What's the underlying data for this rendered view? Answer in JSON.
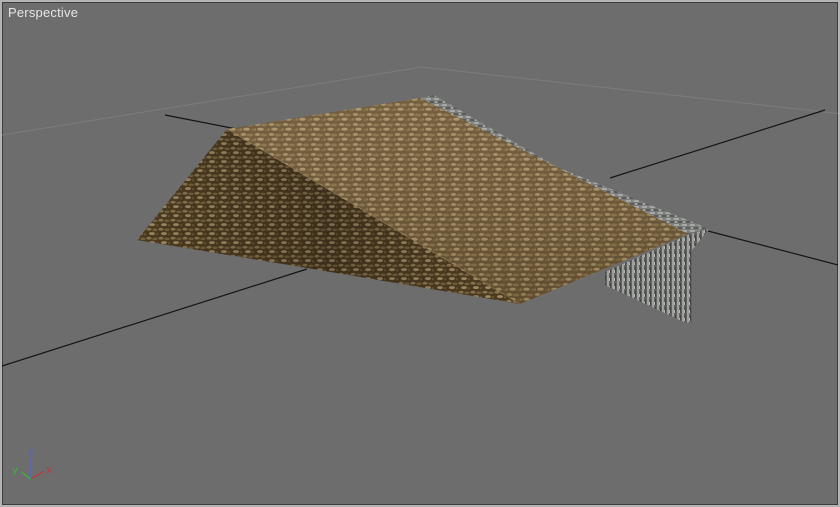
{
  "viewport": {
    "label": "Perspective",
    "background_color": "#6d6d6d"
  },
  "gizmo": {
    "x_label": "x",
    "y_label": "y",
    "z_label": "z",
    "x_color": "#c83232",
    "y_color": "#3cb43c",
    "z_color": "#5064d2"
  },
  "scene": {
    "ground_texture": "dirt-texture",
    "wall_texture": "stone-texture"
  }
}
